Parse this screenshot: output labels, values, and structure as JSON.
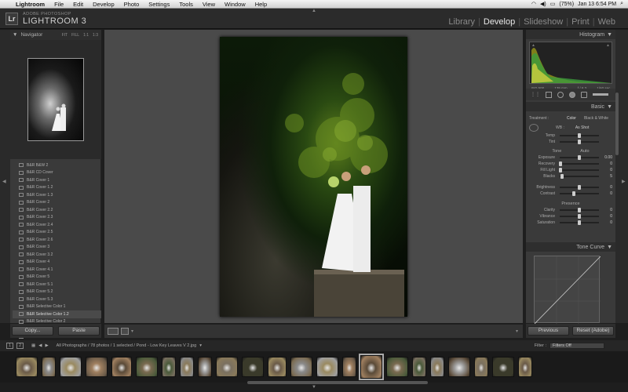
{
  "menubar": {
    "app": "Lightroom",
    "items": [
      "File",
      "Edit",
      "Develop",
      "Photo",
      "Settings",
      "Tools",
      "View",
      "Window",
      "Help"
    ],
    "battery": "(75%)",
    "datetime": "Jan 13  6:54 PM"
  },
  "header": {
    "brand_top": "ADOBE PHOTOSHOP",
    "brand_main": "LIGHTROOM 3",
    "logo": "Lr",
    "modules": [
      "Library",
      "Develop",
      "Slideshow",
      "Print",
      "Web"
    ],
    "active_module": "Develop"
  },
  "navigator": {
    "title": "Navigator",
    "zooms": [
      "FIT",
      "FILL",
      "1:1",
      "1:3"
    ]
  },
  "presets": [
    "B&R B&W 2",
    "B&R CD Cover",
    "B&R Cover 1",
    "B&R Cover 1.2",
    "B&R Cover 1.3",
    "B&R Cover 2",
    "B&R Cover 2.2",
    "B&R Cover 2.3",
    "B&R Cover 2.4",
    "B&R Cover 2.5",
    "B&R Cover 2.6",
    "B&R Cover 3",
    "B&R Cover 3.2",
    "B&R Cover 4",
    "B&R Cover 4.1",
    "B&R Cover 5",
    "B&R Cover 5.1",
    "B&R Cover 5.2",
    "B&R Cover 5.3",
    "B&R Selective Color 1",
    "B&R Selective Color 1.2",
    "B&R Selective Color 2",
    "Basement 1",
    "Beach 1",
    "Beach 1.2",
    "Beach 1.3"
  ],
  "selected_preset_index": 20,
  "left_buttons": {
    "copy": "Copy...",
    "paste": "Paste"
  },
  "histogram": {
    "title": "Histogram",
    "info": [
      "ISO 500",
      "135 mm",
      "f / 6.3",
      "1/60 sec"
    ]
  },
  "basic": {
    "title": "Basic",
    "treatment_label": "Treatment :",
    "treatment_color": "Color",
    "treatment_bw": "Black & White",
    "wb_label": "WB :",
    "wb_value": "As Shot",
    "temp_tint": [
      {
        "label": "Temp",
        "val": "",
        "pos": 0.5
      },
      {
        "label": "Tint",
        "val": "",
        "pos": 0.5
      }
    ],
    "tone_label": "Tone",
    "auto_label": "Auto",
    "tone": [
      {
        "label": "Exposure",
        "val": "0.00",
        "pos": 0.5
      },
      {
        "label": "Recovery",
        "val": "0",
        "pos": 0.02
      },
      {
        "label": "Fill Light",
        "val": "0",
        "pos": 0.02
      },
      {
        "label": "Blacks",
        "val": "5",
        "pos": 0.06
      }
    ],
    "tone2": [
      {
        "label": "Brightness",
        "val": "0",
        "pos": 0.5
      },
      {
        "label": "Contrast",
        "val": "0",
        "pos": 0.35
      }
    ],
    "presence_label": "Presence",
    "presence": [
      {
        "label": "Clarity",
        "val": "0",
        "pos": 0.5
      },
      {
        "label": "Vibrance",
        "val": "0",
        "pos": 0.5
      },
      {
        "label": "Saturation",
        "val": "0",
        "pos": 0.5
      }
    ]
  },
  "tonecurve": {
    "title": "Tone Curve"
  },
  "right_buttons": {
    "previous": "Previous",
    "reset": "Reset (Adobe)"
  },
  "filmbar": {
    "pages": [
      "1",
      "2"
    ],
    "path": "All Photographs / 78 photos / 1 selected / Pond - Low Key Leaves V 2.jpg",
    "filter_label": "Filter :",
    "filter_value": "Filters Off"
  },
  "filmstrip": {
    "selected_index": 15,
    "widths": [
      28,
      18,
      28,
      28,
      26,
      28,
      18,
      18,
      18,
      28,
      28,
      24,
      28,
      28,
      18,
      28,
      28,
      18,
      18,
      28,
      18,
      28,
      18
    ]
  }
}
